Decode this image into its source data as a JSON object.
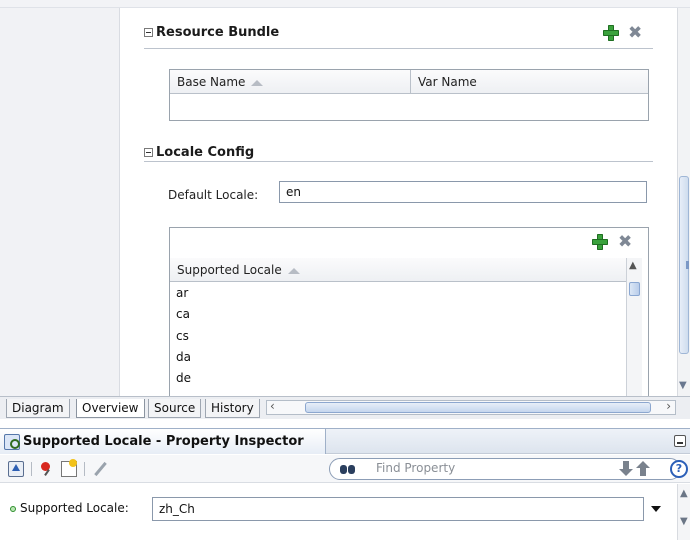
{
  "resource_bundle": {
    "title": "Resource Bundle",
    "columns": [
      "Base Name",
      "Var Name"
    ]
  },
  "locale_config": {
    "title": "Locale Config",
    "default_locale_label": "Default Locale:",
    "default_locale_value": "en",
    "supported_header": "Supported Locale",
    "supported_items": [
      "ar",
      "ca",
      "cs",
      "da",
      "de"
    ]
  },
  "tabs": [
    "Diagram",
    "Overview",
    "Source",
    "History"
  ],
  "active_tab": "Overview",
  "inspector": {
    "title": "Supported Locale - Property Inspector",
    "find_placeholder": "Find Property",
    "help_label": "?",
    "property_label": "Supported Locale:",
    "property_value": "zh_Ch"
  },
  "colors": {
    "add_icon": "#3aa23c",
    "remove_icon": "#7f8895",
    "inspector_accent": "#2b5fb8"
  }
}
